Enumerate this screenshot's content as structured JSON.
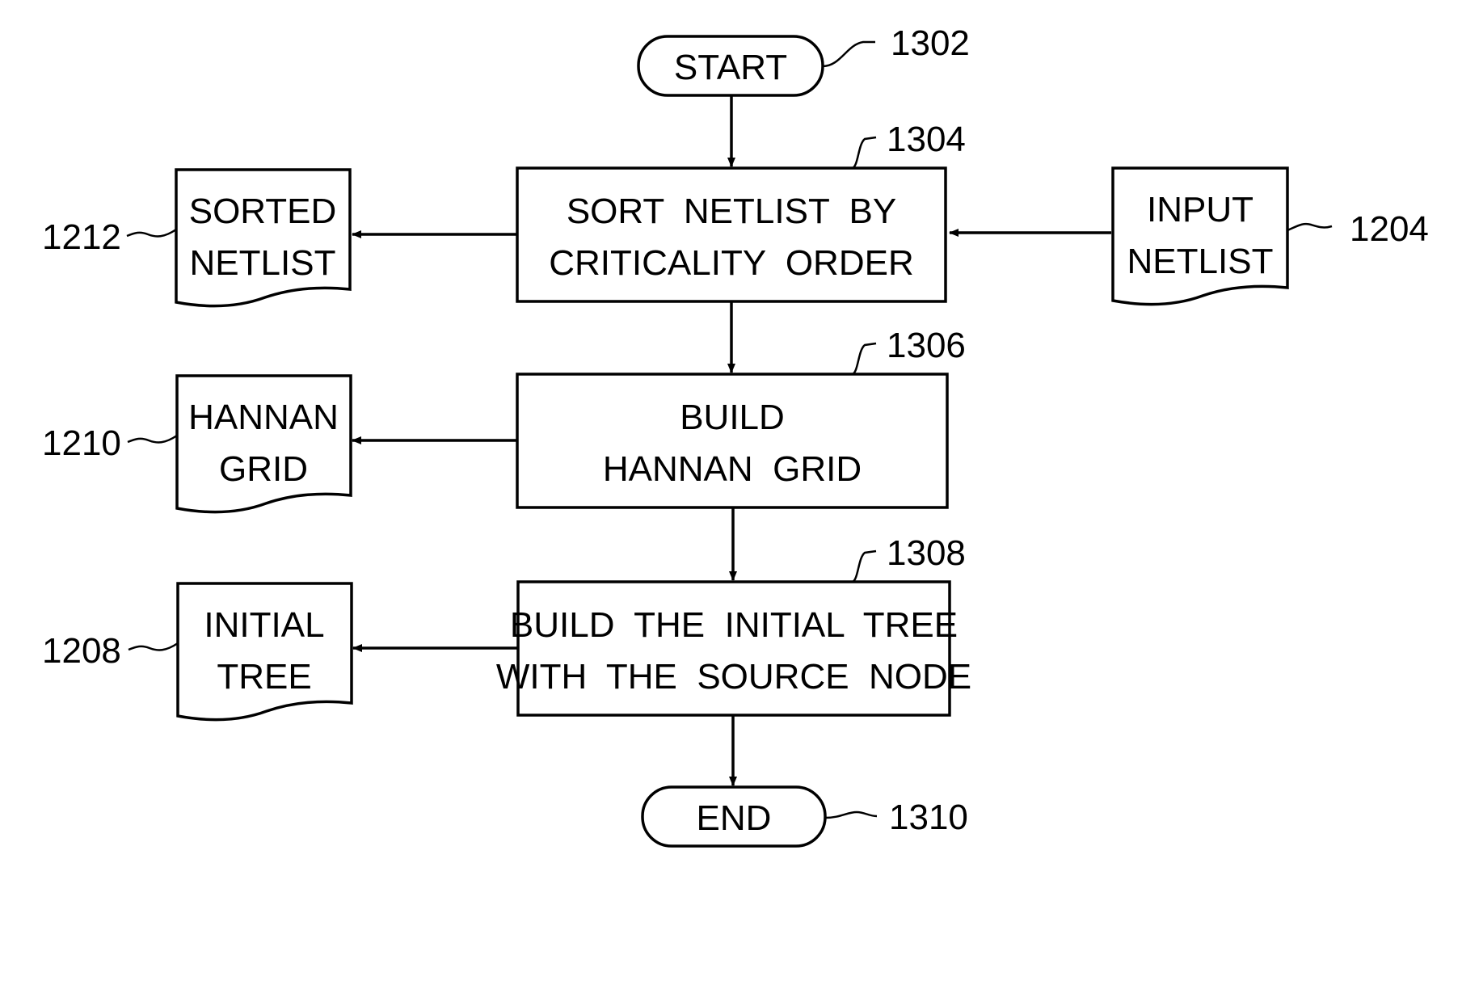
{
  "diagram": {
    "type": "flowchart",
    "nodes": {
      "start": {
        "ref": "1302",
        "lines": [
          "START"
        ]
      },
      "sort": {
        "ref": "1304",
        "lines": [
          "SORT  NETLIST  BY",
          "CRITICALITY  ORDER"
        ]
      },
      "build_grid": {
        "ref": "1306",
        "lines": [
          "BUILD",
          "HANNAN  GRID"
        ]
      },
      "build_tree": {
        "ref": "1308",
        "lines": [
          "BUILD  THE  INITIAL  TREE",
          "WITH  THE  SOURCE  NODE"
        ]
      },
      "end": {
        "ref": "1310",
        "lines": [
          "END"
        ]
      },
      "input_netlist": {
        "ref": "1204",
        "lines": [
          "INPUT",
          "NETLIST"
        ]
      },
      "sorted_netlist": {
        "ref": "1212",
        "lines": [
          "SORTED",
          "NETLIST"
        ]
      },
      "hannan_grid": {
        "ref": "1210",
        "lines": [
          "HANNAN",
          "GRID"
        ]
      },
      "initial_tree": {
        "ref": "1208",
        "lines": [
          "INITIAL",
          "TREE"
        ]
      }
    },
    "edges": [
      [
        "start",
        "sort"
      ],
      [
        "input_netlist",
        "sort"
      ],
      [
        "sort",
        "sorted_netlist"
      ],
      [
        "sort",
        "build_grid"
      ],
      [
        "build_grid",
        "hannan_grid"
      ],
      [
        "build_grid",
        "build_tree"
      ],
      [
        "build_tree",
        "initial_tree"
      ],
      [
        "build_tree",
        "end"
      ]
    ]
  }
}
